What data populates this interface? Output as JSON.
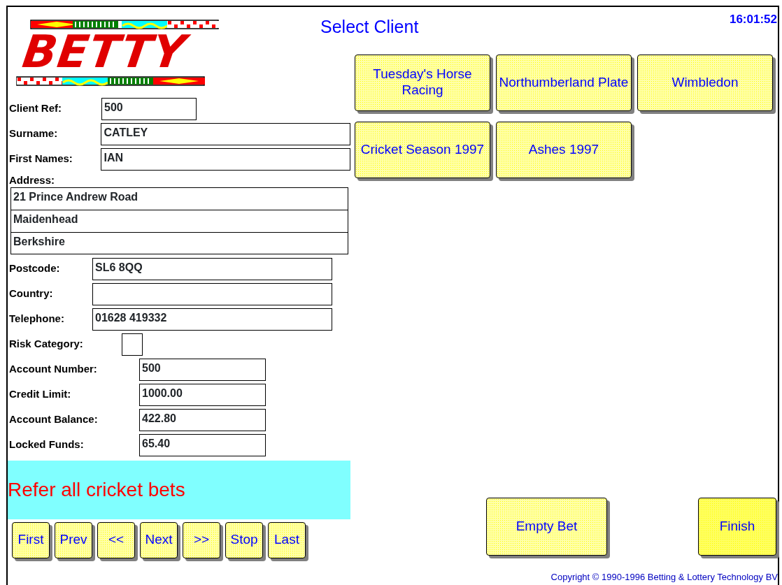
{
  "logo": {
    "text": "BETTY"
  },
  "title": "Select Client",
  "clock": "16:01:52",
  "client_fields": [
    {
      "label": "Client Ref:",
      "value": "500",
      "kind": "short"
    },
    {
      "label": "Surname:",
      "value": "CATLEY",
      "kind": "long"
    },
    {
      "label": "First Names:",
      "value": "IAN",
      "kind": "long"
    }
  ],
  "address": {
    "label": "Address:",
    "lines": [
      "21 Prince Andrew Road",
      "Maidenhead",
      "Berkshire"
    ]
  },
  "contact_fields": [
    {
      "label": "Postcode:",
      "value": "SL6 8QQ"
    },
    {
      "label": "Country:"
    },
    {
      "label": "Telephone:",
      "value": "01628 419332"
    }
  ],
  "risk_category": {
    "label": "Risk Category:"
  },
  "account_fields": [
    {
      "label": "Account Number:",
      "value": "500"
    },
    {
      "label": "Credit Limit:",
      "value": "1000.00"
    },
    {
      "label": "Account Balance:",
      "value": "422.80"
    },
    {
      "label": "Locked Funds:",
      "value": "65.40"
    }
  ],
  "note": "Refer all cricket bets",
  "nav_buttons": [
    "First",
    "Prev",
    "<<",
    "Next",
    ">>",
    "Stop",
    "Last"
  ],
  "event_buttons": [
    "Tuesday's Horse Racing",
    "Northumberland Plate",
    "Wimbledon",
    "Cricket Season 1997",
    "Ashes 1997"
  ],
  "action_buttons": [
    {
      "label": "Empty Bet",
      "kind": "light"
    },
    {
      "label": "Finish",
      "kind": "bright"
    }
  ],
  "copyright": "Copyright © 1990-1996 Betting & Lottery Technology BV"
}
